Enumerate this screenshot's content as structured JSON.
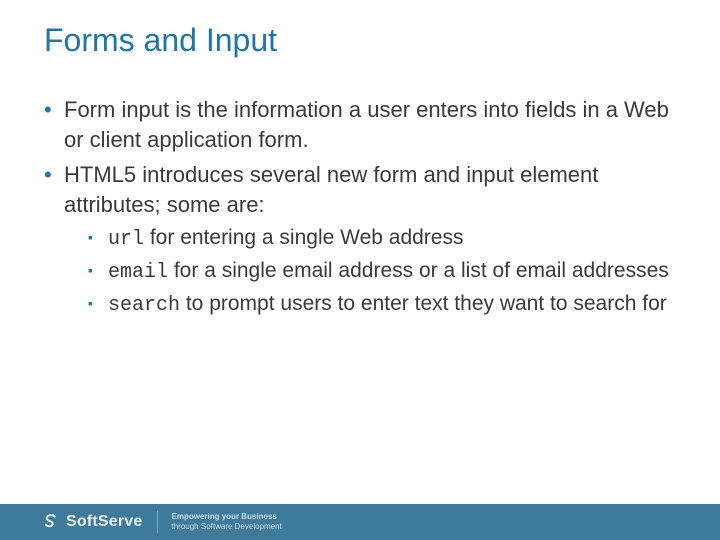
{
  "title": "Forms and Input",
  "bullets": {
    "b1": "Form input is the information a user enters into fields in a Web or client application form.",
    "b2": "HTML5 introduces several new form and input element attributes; some are:",
    "sub": {
      "s1_code": "url",
      "s1_text": " for entering a single Web address",
      "s2_code": "email",
      "s2_text": " for a single email address or a list of email addresses",
      "s3_code": "search",
      "s3_text": " to prompt users to enter text they want to search for"
    }
  },
  "footer": {
    "brand": "SoftServe",
    "tagline1": "Empowering your Business",
    "tagline2": "through Software Development"
  }
}
